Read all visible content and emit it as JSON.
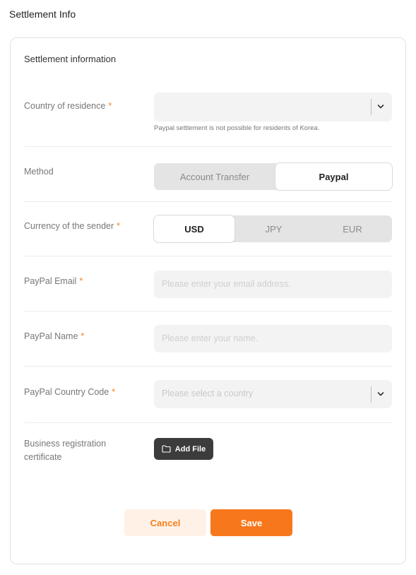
{
  "page": {
    "title": "Settlement Info"
  },
  "section": {
    "title": "Settlement information"
  },
  "required_mark": "*",
  "country_residence": {
    "label": "Country of residence",
    "value": "",
    "hint": "Paypal settlement is not possible for residents of Korea."
  },
  "method": {
    "label": "Method",
    "options": [
      "Account Transfer",
      "Paypal"
    ],
    "selected": "Paypal"
  },
  "currency": {
    "label": "Currency of the sender",
    "options": [
      "USD",
      "JPY",
      "EUR"
    ],
    "selected": "USD"
  },
  "paypal_email": {
    "label": "PayPal Email",
    "placeholder": "Please enter your email address."
  },
  "paypal_name": {
    "label": "PayPal Name",
    "placeholder": "Please enter your name."
  },
  "paypal_country": {
    "label": "PayPal Country Code",
    "placeholder": "Please select a country"
  },
  "business_cert": {
    "label_line1": "Business registration",
    "label_line2": "certificate",
    "button": "Add File"
  },
  "actions": {
    "cancel": "Cancel",
    "save": "Save"
  },
  "colors": {
    "accent": "#f7811f",
    "accent_light": "#fff1e6",
    "dark_button": "#3c3c3c"
  },
  "icons": {
    "dropdown": "chevron-down-icon",
    "folder": "folder-icon"
  }
}
